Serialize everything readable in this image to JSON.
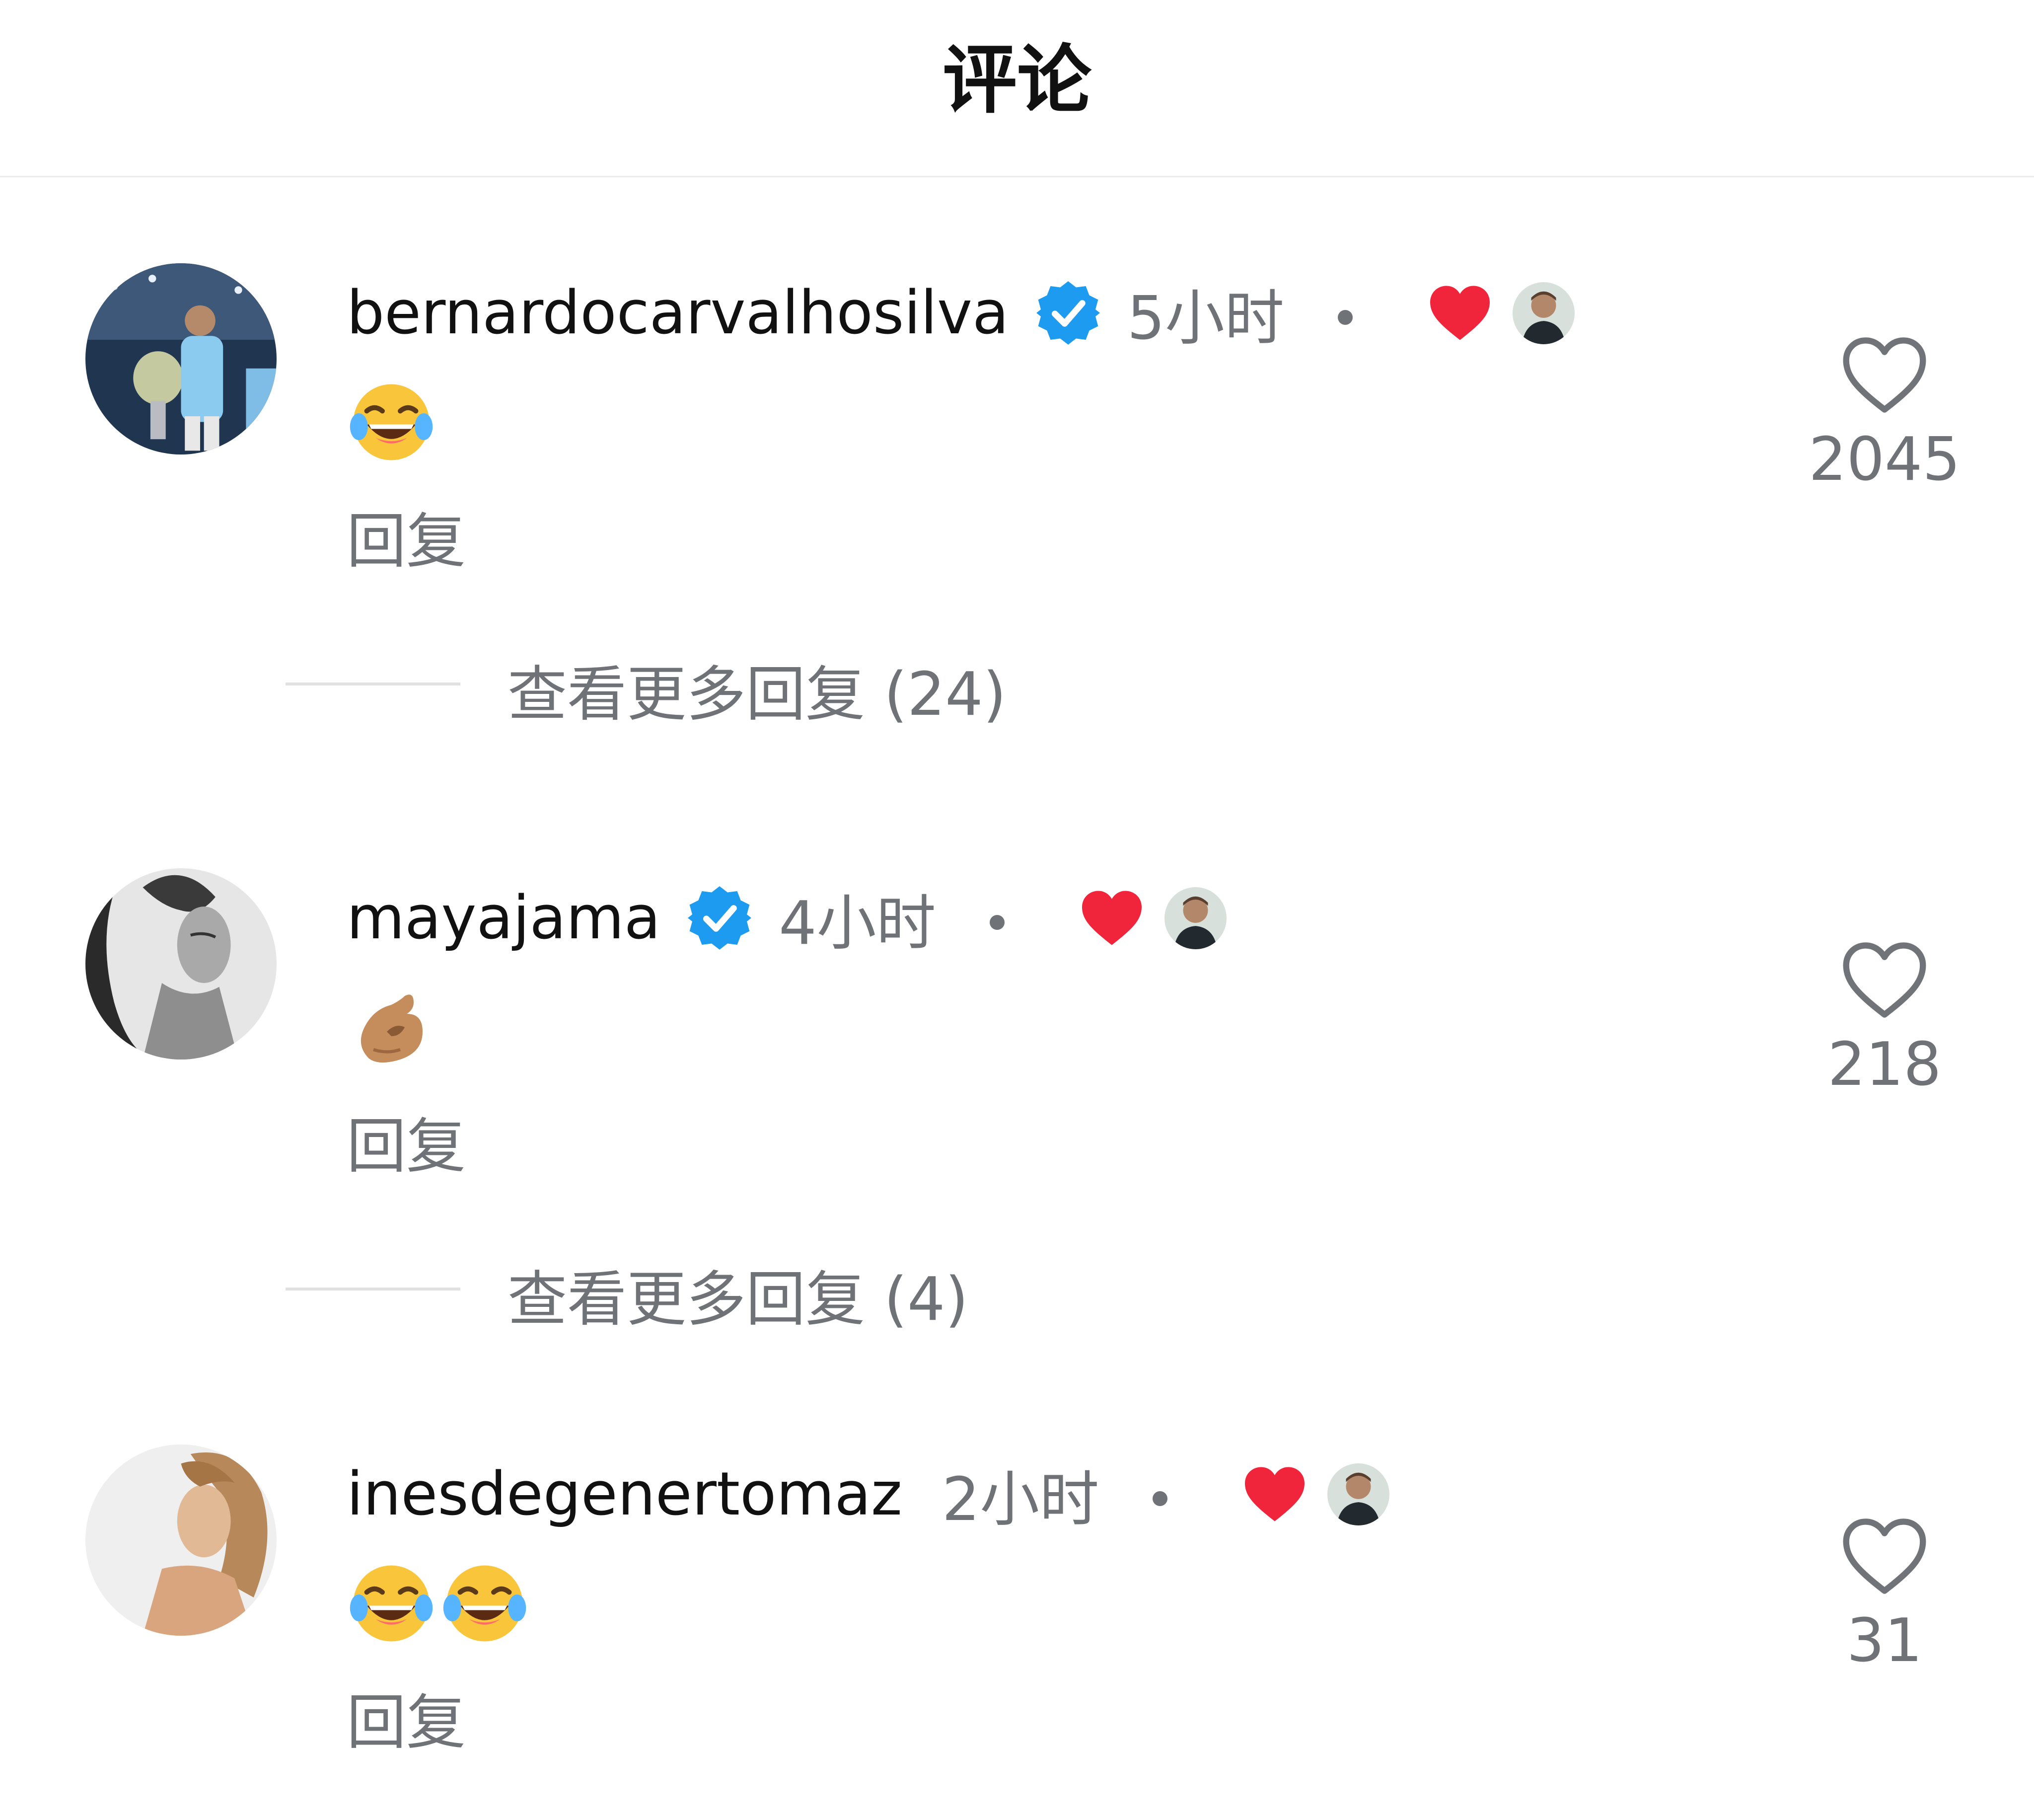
{
  "header": {
    "title": "评论"
  },
  "comments": [
    {
      "username": "bernardocarvalhosilva",
      "verified": true,
      "time": "5小时",
      "liked_by_author": true,
      "emoji": [
        "face-with-tears-of-joy"
      ],
      "reply_label": "回复",
      "likes": "2045",
      "more_replies": "查看更多回复 (24)"
    },
    {
      "username": "mayajama",
      "verified": true,
      "time": "4小时",
      "liked_by_author": true,
      "emoji": [
        "pinching-hand"
      ],
      "reply_label": "回复",
      "likes": "218",
      "more_replies": "查看更多回复 (4)"
    },
    {
      "username": "inesdegenertomaz",
      "verified": false,
      "time": "2小时",
      "liked_by_author": true,
      "emoji": [
        "face-with-tears-of-joy",
        "face-with-tears-of-joy"
      ],
      "reply_label": "回复",
      "likes": "31"
    }
  ],
  "colors": {
    "verified_badge": "#1d9bf0",
    "heart_red": "#f0243a",
    "meta_gray": "#6f7378"
  },
  "icons": [
    "verified-badge-icon",
    "red-heart-icon",
    "like-heart-outline-icon",
    "laughing-emoji",
    "pinching-hand-emoji"
  ]
}
